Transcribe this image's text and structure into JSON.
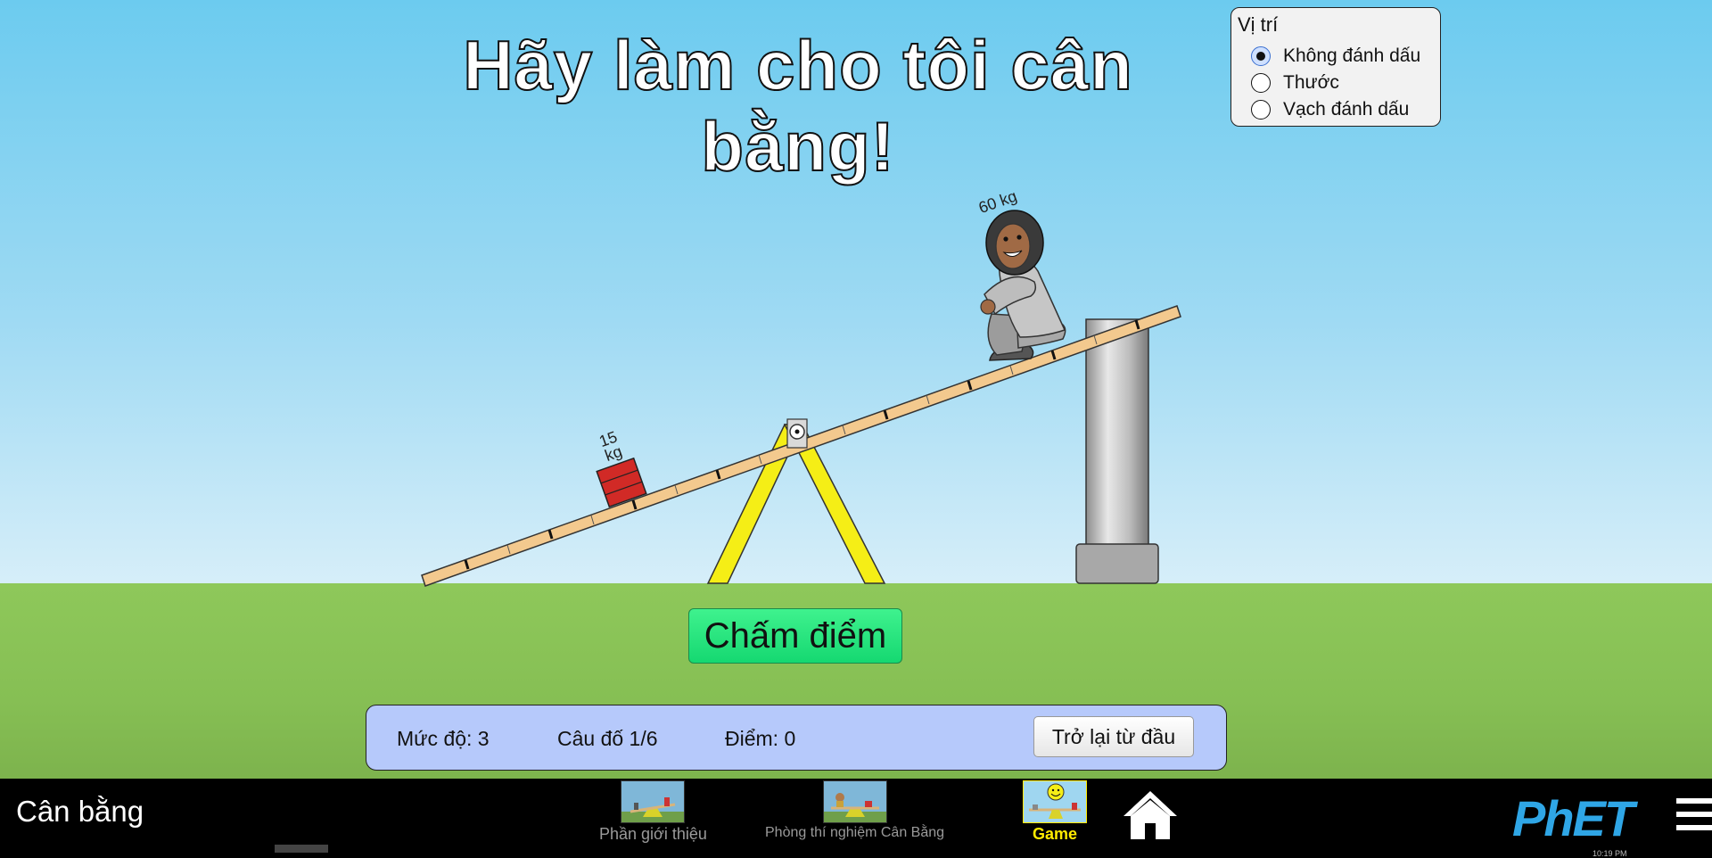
{
  "title": "Hãy làm cho tôi cân bằng!",
  "position_panel": {
    "title": "Vị trí",
    "options": [
      "Không đánh dấu",
      "Thước",
      "Vạch đánh dấu"
    ],
    "selected": "Không đánh dấu"
  },
  "masses": {
    "brick_label_line1": "15",
    "brick_label_line2": "kg",
    "person_label": "60 kg"
  },
  "check_button": "Chấm điểm",
  "status": {
    "level": "Mức độ: 3",
    "challenge": "Câu đố 1/6",
    "score": "Điểm: 0",
    "restart": "Trở lại từ đầu"
  },
  "navbar": {
    "sim_title": "Cân bằng",
    "screens": [
      {
        "label": "Phần giới thiệu",
        "active": false
      },
      {
        "label": "Phòng thí nghiệm Cân Bằng",
        "active": false
      },
      {
        "label": "Game",
        "active": true
      }
    ],
    "brand": "PhET",
    "clock": "10:19 PM"
  },
  "colors": {
    "plank": "#f3c98e",
    "fulcrum": "#f5ee16",
    "brick": "#d12a26",
    "check_button": "#25e57d",
    "status_bar": "#b6c9fb",
    "active_tab": "#ffeb00"
  }
}
